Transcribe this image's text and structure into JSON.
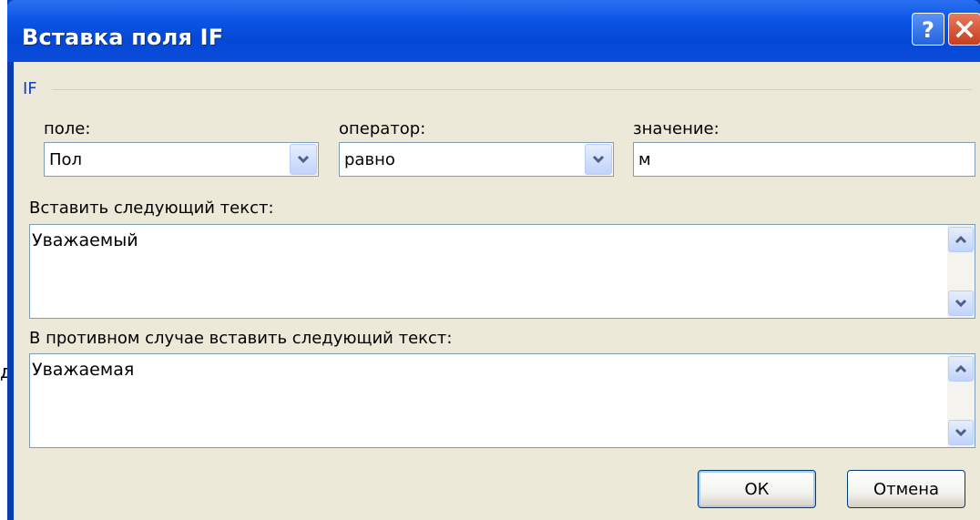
{
  "window": {
    "title": "Вставка поля IF"
  },
  "group": {
    "title": "IF"
  },
  "field": {
    "label": "поле:",
    "value": "Пол"
  },
  "operator": {
    "label": "оператор:",
    "value": "равно"
  },
  "value_field": {
    "label": "значение:",
    "value": "м"
  },
  "insert_text": {
    "label": "Вставить следующий текст:",
    "value": "Уважаемый"
  },
  "else_text": {
    "label": "В противном случае вставить следующий текст:",
    "value": "Уважаемая"
  },
  "buttons": {
    "ok": "ОК",
    "cancel": "Отмена"
  },
  "outside": {
    "glyph": "д"
  }
}
